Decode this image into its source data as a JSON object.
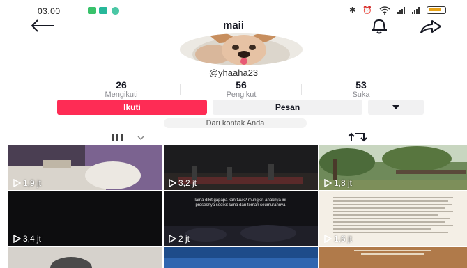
{
  "status_bar": {
    "time": "03.00",
    "icons": [
      "app-notification-icon",
      "app-notification-icon",
      "app-notification-icon",
      "bluetooth-icon",
      "alarm-icon",
      "wifi-icon",
      "signal-icon",
      "signal-icon",
      "battery-icon"
    ]
  },
  "header": {
    "title": "maii",
    "icons": {
      "back": "arrow-left-icon",
      "bell": "bell-icon",
      "share": "share-arrow-icon"
    }
  },
  "profile": {
    "username": "@yhaaha23",
    "stats": [
      {
        "value": "26",
        "label": "Mengikuti"
      },
      {
        "value": "56",
        "label": "Pengikut"
      },
      {
        "value": "53",
        "label": "Suka"
      }
    ]
  },
  "actions": {
    "follow_label": "Ikuti",
    "message_label": "Pesan",
    "more_icon": "caret-down-icon"
  },
  "contact_note": "Dari kontak Anda",
  "tabs": {
    "videos_icon": "grid-icon",
    "reposts_icon": "repost-icon"
  },
  "videos": [
    {
      "views": "1,9 jt"
    },
    {
      "views": "3,2 jt"
    },
    {
      "views": "1,8 jt"
    },
    {
      "views": "3,4 jt"
    },
    {
      "views": "2 jt"
    },
    {
      "views": "1,6 jt"
    },
    {
      "views": ""
    },
    {
      "views": ""
    },
    {
      "views": ""
    }
  ],
  "video_captions": {
    "v5": "lama dikit gapapa kan tuuk? mungkin anaknya ini prosesnya sedikit lama dari teman seumurannya"
  },
  "colors": {
    "accent": "#fe2c55",
    "secondary_button": "#f1f1f2",
    "text_primary": "#161823",
    "text_secondary": "#8a8b91"
  }
}
